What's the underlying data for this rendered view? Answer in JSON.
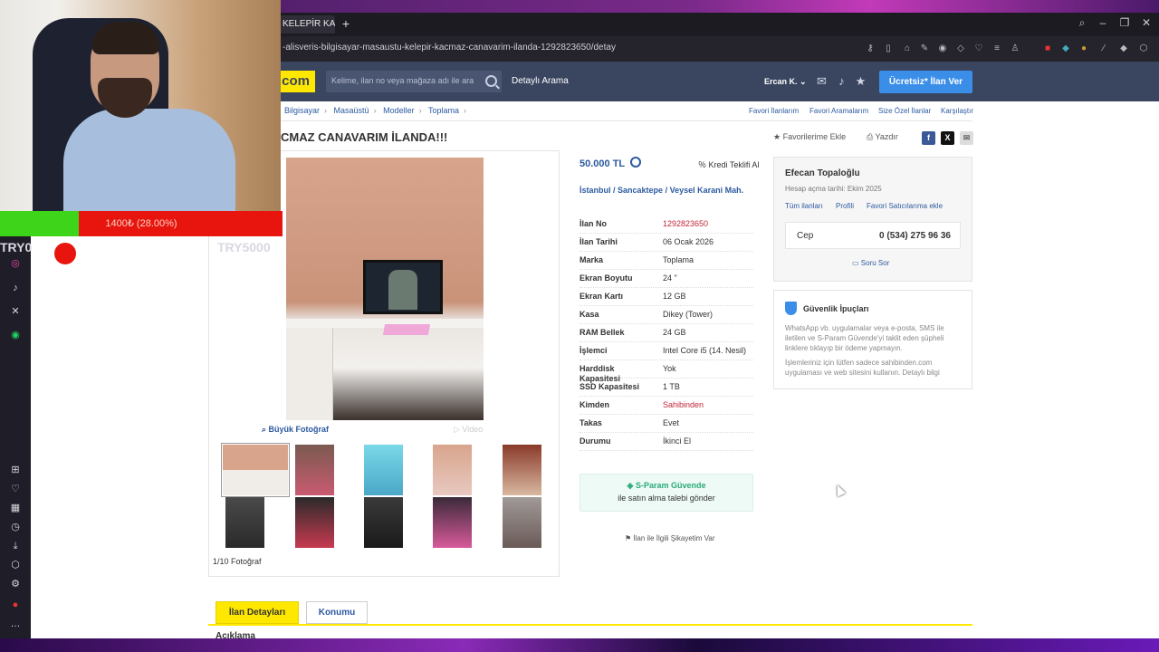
{
  "browser": {
    "tab_title": "KELEPİR KAÇM",
    "url": "-alisveris-bilgisayar-masaustu-kelepir-kacmaz-canavarim-ilanda-1292823650/detay"
  },
  "overlay": {
    "donation_text": "1400₺ (28.00%)",
    "goal_start": "TRY0",
    "goal_end": "TRY5000",
    "donation_percent": 28
  },
  "header": {
    "logo": ".com",
    "search_placeholder": "Kelime, ilan no veya mağaza adı ile ara",
    "advanced_search": "Detaylı Arama",
    "user": "Ercan K.",
    "post_ad": "Ücretsiz* İlan Ver"
  },
  "breadcrumb": [
    "Bilgisayar",
    "Masaüstü",
    "Modeller",
    "Toplama"
  ],
  "fav_links": [
    "Favori İlanlarım",
    "Favori Aramalarım",
    "Size Özel İlanlar",
    "Karşılaştır"
  ],
  "listing": {
    "title": "CMAZ CANAVARIM İLANDA!!!",
    "add_favorite": "Favorilerime Ekle",
    "print": "Yazdır",
    "price": "50.000 TL",
    "credit_offer": "Kredi Teklifi Al",
    "location": [
      "İstanbul",
      "Sancaktepe",
      "Veysel Karani Mah."
    ],
    "big_photo": "Büyük Fotoğraf",
    "video": "Video",
    "photo_count": "1/10 Fotoğraf",
    "specs": [
      {
        "k": "İlan No",
        "v": "1292823650",
        "red": true
      },
      {
        "k": "İlan Tarihi",
        "v": "06 Ocak 2026"
      },
      {
        "k": "Marka",
        "v": "Toplama"
      },
      {
        "k": "Ekran Boyutu",
        "v": "24 \""
      },
      {
        "k": "Ekran Kartı",
        "v": "12 GB"
      },
      {
        "k": "Kasa",
        "v": "Dikey (Tower)"
      },
      {
        "k": "RAM Bellek",
        "v": "24 GB"
      },
      {
        "k": "İşlemci",
        "v": "Intel Core i5 (14. Nesil)"
      },
      {
        "k": "Harddisk Kapasitesi",
        "v": "Yok"
      },
      {
        "k": "SSD Kapasitesi",
        "v": "1 TB"
      },
      {
        "k": "Kimden",
        "v": "Sahibinden",
        "red": true
      },
      {
        "k": "Takas",
        "v": "Evet"
      },
      {
        "k": "Durumu",
        "v": "İkinci El"
      }
    ],
    "sparam_title": "S-Param Güvende",
    "sparam_sub": "ile satın alma talebi gönder",
    "complaint": "İlan ile İlgili Şikayetim Var"
  },
  "seller": {
    "name": "Efecan Topaloğlu",
    "joined": "Hesap açma tarihi: Ekim 2025",
    "links": [
      "Tüm ilanları",
      "Profili",
      "Favori Satıcılarıma ekle"
    ],
    "phone_label": "Cep",
    "phone": "0 (534) 275 96 36",
    "ask": "Soru Sor"
  },
  "safety": {
    "title": "Güvenlik İpuçları",
    "p1": "WhatsApp vb. uygulamalar veya e-posta, SMS ile iletilen ve S-Param Güvende'yi taklit eden şüpheli linklere tıklayıp bir ödeme yapmayın.",
    "p2": "İşlemleriniz için lütfen sadece sahibinden.com uygulaması ve web sitesini kullanın. Detaylı bilgi"
  },
  "tabs": [
    "İlan Detayları",
    "Konumu"
  ],
  "description_heading": "Açıklama"
}
